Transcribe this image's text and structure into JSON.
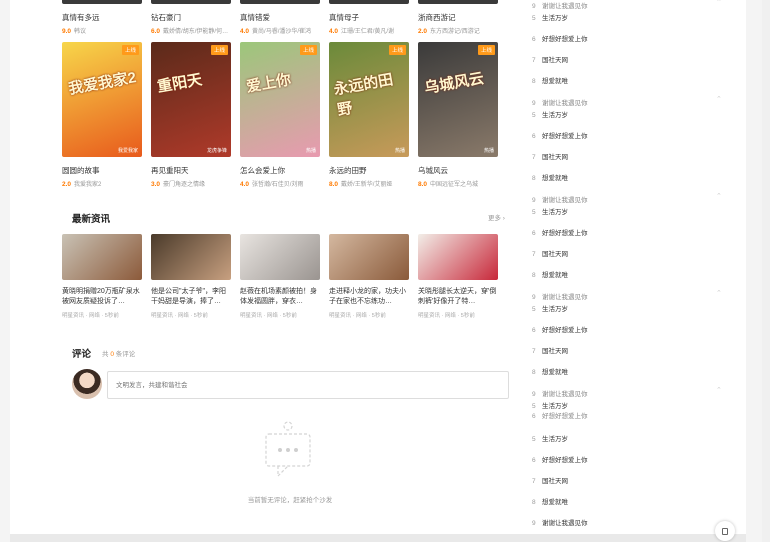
{
  "top_cards": [
    {
      "title": "真情有多远",
      "score": "9.0",
      "desc": "韩议"
    },
    {
      "title": "钻石豪门",
      "score": "6.0",
      "desc": "戴娇倩/胡东/伊能静/何润东"
    },
    {
      "title": "真情错爱",
      "score": "4.0",
      "desc": "黄尚/马睿/潘沙华/崔鸿"
    },
    {
      "title": "真情母子",
      "score": "4.0",
      "desc": "江珊/王仁君/黄凡/谢"
    },
    {
      "title": "浙商西游记",
      "score": "2.0",
      "desc": "东方西游记/西游记"
    }
  ],
  "poster_cards": [
    {
      "title": "圆圆的故事",
      "score": "2.0",
      "desc": "我爱我家2",
      "badge": "上线",
      "poster_title": "我爱我家2",
      "poster_foot": "我爱我家",
      "colors": [
        "#f7d64a",
        "#e85a1c"
      ]
    },
    {
      "title": "再见重阳天",
      "score": "3.0",
      "desc": "豪门角逐之情缘",
      "badge": "上线",
      "poster_title": "重阳天",
      "poster_foot": "龙虎争锋",
      "colors": [
        "#5a2a1a",
        "#b03a2a"
      ]
    },
    {
      "title": "怎么会爱上你",
      "score": "4.0",
      "desc": "张哲瀚/石佳贝/刘雨",
      "badge": "上线",
      "poster_title": "爱上你",
      "poster_foot": "热播",
      "colors": [
        "#9bc77a",
        "#e89ab0"
      ]
    },
    {
      "title": "永远的田野",
      "score": "8.0",
      "desc": "戴娇/王新华/艾丽娅",
      "badge": "上线",
      "poster_title": "永远的田野",
      "poster_foot": "热播",
      "colors": [
        "#6a8a3a",
        "#c89a5a"
      ]
    },
    {
      "title": "乌城风云",
      "score": "8.0",
      "desc": "中国远征军之乌城",
      "badge": "上线",
      "poster_title": "乌城风云",
      "poster_foot": "热播",
      "colors": [
        "#3a3a3a",
        "#8a7a6a"
      ]
    }
  ],
  "news_section": {
    "title": "最新资讯",
    "more": "更多 ›"
  },
  "news": [
    {
      "title": "黄晓明捐赠20万瓶矿泉水被网友质疑投诉了…",
      "meta": "明星资讯 · 网络 · 5秒前",
      "colors": [
        "#c9c2b5",
        "#8c5a3a"
      ]
    },
    {
      "title": "他是公司\"太子爷\"，李阳干妈甜是导演，捧了…",
      "meta": "明星资讯 · 网络 · 5秒前",
      "colors": [
        "#4a3a2a",
        "#c8a080"
      ]
    },
    {
      "title": "赵薇在机场素颜被拍！身体发福圆胖，穿衣…",
      "meta": "明星资讯 · 网络 · 5秒前",
      "colors": [
        "#e8e4e0",
        "#9a9490"
      ]
    },
    {
      "title": "走进释小龙的家，功夫小子在家也不忘练功…",
      "meta": "明星资讯 · 网络 · 5秒前",
      "colors": [
        "#d4b8a0",
        "#8a5a3a"
      ]
    },
    {
      "title": "关晓彤腿长太逆天，穿'倒刺裤'好像开了特…",
      "meta": "明星资讯 · 网络 · 5秒前",
      "colors": [
        "#f2eee8",
        "#c8283a"
      ]
    }
  ],
  "comments": {
    "title": "评论",
    "count_prefix": "共",
    "count": "0",
    "count_suffix": "条评论",
    "placeholder": "文明发言，共建和谐社会",
    "empty": "当前暂无评论，赶紧抢个沙发"
  },
  "rank_lists": [
    {
      "items": [
        {
          "idx": "9",
          "name": "谢谢让我遇见你",
          "partial": true
        },
        {
          "idx": "5",
          "name": "生活万岁"
        },
        {
          "idx": "6",
          "name": "好想好想爱上你"
        },
        {
          "idx": "7",
          "name": "国社天网"
        },
        {
          "idx": "8",
          "name": "想爱就唯"
        }
      ]
    },
    {
      "items": [
        {
          "idx": "9",
          "name": "谢谢让我遇见你",
          "partial": true
        },
        {
          "idx": "5",
          "name": "生活万岁"
        },
        {
          "idx": "6",
          "name": "好想好想爱上你"
        },
        {
          "idx": "7",
          "name": "国社天网"
        },
        {
          "idx": "8",
          "name": "想爱就唯"
        }
      ]
    },
    {
      "items": [
        {
          "idx": "9",
          "name": "谢谢让我遇见你",
          "partial": true
        },
        {
          "idx": "5",
          "name": "生活万岁"
        },
        {
          "idx": "6",
          "name": "好想好想爱上你"
        },
        {
          "idx": "7",
          "name": "国社天网"
        },
        {
          "idx": "8",
          "name": "想爱就唯"
        }
      ]
    },
    {
      "items": [
        {
          "idx": "9",
          "name": "谢谢让我遇见你",
          "partial": true
        },
        {
          "idx": "5",
          "name": "生活万岁"
        },
        {
          "idx": "6",
          "name": "好想好想爱上你"
        },
        {
          "idx": "7",
          "name": "国社天网"
        },
        {
          "idx": "8",
          "name": "想爱就唯"
        }
      ]
    },
    {
      "items": [
        {
          "idx": "9",
          "name": "谢谢让我遇见你",
          "partial": true
        },
        {
          "idx": "5",
          "name": "生活万岁"
        },
        {
          "idx": "6",
          "name": "好想好想爱上你",
          "partial": true
        }
      ]
    },
    {
      "items": [
        {
          "idx": "5",
          "name": "生活万岁"
        },
        {
          "idx": "6",
          "name": "好想好想爱上你"
        },
        {
          "idx": "7",
          "name": "国社天网"
        },
        {
          "idx": "8",
          "name": "想爱就唯"
        },
        {
          "idx": "9",
          "name": "谢谢让我遇见你"
        }
      ]
    }
  ],
  "accent": "#ff7a00"
}
